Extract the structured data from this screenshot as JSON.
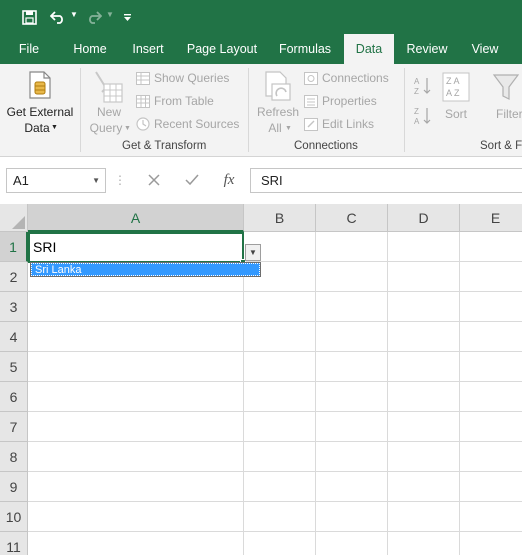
{
  "quick_access": {
    "save_icon": "save-icon",
    "undo_icon": "undo-icon",
    "redo_icon": "redo-icon",
    "customize_icon": "customize-toolbar-icon"
  },
  "tabs": [
    {
      "label": "File"
    },
    {
      "label": "Home"
    },
    {
      "label": "Insert"
    },
    {
      "label": "Page Layout"
    },
    {
      "label": "Formulas"
    },
    {
      "label": "Data",
      "active": true
    },
    {
      "label": "Review"
    },
    {
      "label": "View"
    }
  ],
  "ribbon": {
    "get_external_data": {
      "line1": "Get External",
      "line2": "Data"
    },
    "new_query": {
      "line1": "New",
      "line2": "Query"
    },
    "show_queries": "Show Queries",
    "from_table": "From Table",
    "recent_sources": "Recent Sources",
    "get_transform_label": "Get & Transform",
    "refresh_all": {
      "line1": "Refresh",
      "line2": "All"
    },
    "connections": "Connections",
    "properties": "Properties",
    "edit_links": "Edit Links",
    "connections_label": "Connections",
    "sort_label": "Sort",
    "filter_label": "Filter",
    "sort_filter_label": "Sort & F"
  },
  "formula_bar": {
    "name_box": "A1",
    "fx": "fx",
    "formula": "SRI"
  },
  "grid": {
    "columns": [
      "A",
      "B",
      "C",
      "D",
      "E"
    ],
    "rows": [
      "1",
      "2",
      "3",
      "4",
      "5",
      "6",
      "7",
      "8",
      "9",
      "10",
      "11"
    ],
    "selected_cell": "A1",
    "a1_value": "SRI"
  },
  "autocomplete": {
    "items": [
      "Sri Lanka"
    ]
  },
  "colors": {
    "accent": "#217346",
    "selection": "#3399ff"
  }
}
